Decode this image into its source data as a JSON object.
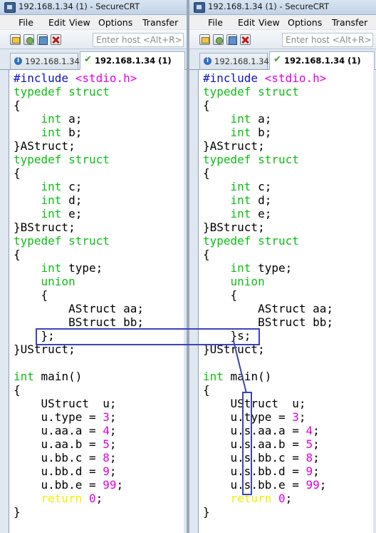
{
  "windows": [
    {
      "title": "192.168.1.34 (1) - SecureCRT",
      "menu": [
        "File",
        "Edit",
        "View",
        "Options",
        "Transfer"
      ],
      "host_placeholder": "Enter host <Alt+R>",
      "tabs": [
        {
          "label": "192.168.1.34",
          "icon": "info-icon",
          "active": false
        },
        {
          "label": "192.168.1.34 (1)",
          "icon": "check-icon",
          "active": true
        }
      ],
      "code": [
        [
          [
            "#include ",
            "pre"
          ],
          [
            "<stdio.h>",
            "inc"
          ]
        ],
        [
          [
            "typedef struct",
            "type"
          ]
        ],
        [
          [
            "{",
            ""
          ]
        ],
        [
          [
            "    ",
            ""
          ],
          [
            "int",
            "type"
          ],
          [
            " a;",
            ""
          ]
        ],
        [
          [
            "    ",
            ""
          ],
          [
            "int",
            "type"
          ],
          [
            " b;",
            ""
          ]
        ],
        [
          [
            "}AStruct;",
            ""
          ]
        ],
        [
          [
            "typedef struct",
            "type"
          ]
        ],
        [
          [
            "{",
            ""
          ]
        ],
        [
          [
            "    ",
            ""
          ],
          [
            "int",
            "type"
          ],
          [
            " c;",
            ""
          ]
        ],
        [
          [
            "    ",
            ""
          ],
          [
            "int",
            "type"
          ],
          [
            " d;",
            ""
          ]
        ],
        [
          [
            "    ",
            ""
          ],
          [
            "int",
            "type"
          ],
          [
            " e;",
            ""
          ]
        ],
        [
          [
            "}BStruct;",
            ""
          ]
        ],
        [
          [
            "typedef struct",
            "type"
          ]
        ],
        [
          [
            "{",
            ""
          ]
        ],
        [
          [
            "    ",
            ""
          ],
          [
            "int",
            "type"
          ],
          [
            " type;",
            ""
          ]
        ],
        [
          [
            "    ",
            ""
          ],
          [
            "union",
            "type"
          ]
        ],
        [
          [
            "    {",
            ""
          ]
        ],
        [
          [
            "        AStruct aa;",
            ""
          ]
        ],
        [
          [
            "        BStruct bb;",
            ""
          ]
        ],
        [
          [
            "    };",
            ""
          ]
        ],
        [
          [
            "}UStruct;",
            ""
          ]
        ],
        [
          [
            "",
            ""
          ]
        ],
        [
          [
            "int",
            "type"
          ],
          [
            " main()",
            ""
          ]
        ],
        [
          [
            "{",
            ""
          ]
        ],
        [
          [
            "    UStruct  u;",
            ""
          ]
        ],
        [
          [
            "    u.type = ",
            ""
          ],
          [
            "3",
            "num"
          ],
          [
            ";",
            ""
          ]
        ],
        [
          [
            "    u.aa.a = ",
            ""
          ],
          [
            "4",
            "num"
          ],
          [
            ";",
            ""
          ]
        ],
        [
          [
            "    u.aa.b = ",
            ""
          ],
          [
            "5",
            "num"
          ],
          [
            ";",
            ""
          ]
        ],
        [
          [
            "    u.bb.c = ",
            ""
          ],
          [
            "8",
            "num"
          ],
          [
            ";",
            ""
          ]
        ],
        [
          [
            "    u.bb.d = ",
            ""
          ],
          [
            "9",
            "num"
          ],
          [
            ";",
            ""
          ]
        ],
        [
          [
            "    u.bb.e = ",
            ""
          ],
          [
            "99",
            "num"
          ],
          [
            ";",
            ""
          ]
        ],
        [
          [
            "    ",
            ""
          ],
          [
            "return",
            "ret"
          ],
          [
            " ",
            ""
          ],
          [
            "0",
            "num"
          ],
          [
            ";",
            ""
          ]
        ],
        [
          [
            "}",
            ""
          ]
        ]
      ]
    },
    {
      "title": "192.168.1.34 (1) - SecureCRT",
      "menu": [
        "File",
        "Edit",
        "View",
        "Options",
        "Transfer"
      ],
      "host_placeholder": "Enter host <Alt+R>",
      "tabs": [
        {
          "label": "192.168.1.34",
          "icon": "info-icon",
          "active": false
        },
        {
          "label": "192.168.1.34 (1)",
          "icon": "check-icon",
          "active": true
        }
      ],
      "code": [
        [
          [
            "#include ",
            "pre"
          ],
          [
            "<stdio.h>",
            "inc"
          ]
        ],
        [
          [
            "typedef struct",
            "type"
          ]
        ],
        [
          [
            "{",
            ""
          ]
        ],
        [
          [
            "    ",
            ""
          ],
          [
            "int",
            "type"
          ],
          [
            " a;",
            ""
          ]
        ],
        [
          [
            "    ",
            ""
          ],
          [
            "int",
            "type"
          ],
          [
            " b;",
            ""
          ]
        ],
        [
          [
            "}AStruct;",
            ""
          ]
        ],
        [
          [
            "typedef struct",
            "type"
          ]
        ],
        [
          [
            "{",
            ""
          ]
        ],
        [
          [
            "    ",
            ""
          ],
          [
            "int",
            "type"
          ],
          [
            " c;",
            ""
          ]
        ],
        [
          [
            "    ",
            ""
          ],
          [
            "int",
            "type"
          ],
          [
            " d;",
            ""
          ]
        ],
        [
          [
            "    ",
            ""
          ],
          [
            "int",
            "type"
          ],
          [
            " e;",
            ""
          ]
        ],
        [
          [
            "}BStruct;",
            ""
          ]
        ],
        [
          [
            "typedef struct",
            "type"
          ]
        ],
        [
          [
            "{",
            ""
          ]
        ],
        [
          [
            "    ",
            ""
          ],
          [
            "int",
            "type"
          ],
          [
            " type;",
            ""
          ]
        ],
        [
          [
            "    ",
            ""
          ],
          [
            "union",
            "type"
          ]
        ],
        [
          [
            "    {",
            ""
          ]
        ],
        [
          [
            "        AStruct aa;",
            ""
          ]
        ],
        [
          [
            "        BStruct bb;",
            ""
          ]
        ],
        [
          [
            "    }s;",
            ""
          ]
        ],
        [
          [
            "}UStruct;",
            ""
          ]
        ],
        [
          [
            "",
            ""
          ]
        ],
        [
          [
            "int",
            "type"
          ],
          [
            " main()",
            ""
          ]
        ],
        [
          [
            "{",
            ""
          ]
        ],
        [
          [
            "    UStruct  u;",
            ""
          ]
        ],
        [
          [
            "    u.type = ",
            ""
          ],
          [
            "3",
            "num"
          ],
          [
            ";",
            ""
          ]
        ],
        [
          [
            "    u.s.aa.a = ",
            ""
          ],
          [
            "4",
            "num"
          ],
          [
            ";",
            ""
          ]
        ],
        [
          [
            "    u.s.aa.b = ",
            ""
          ],
          [
            "5",
            "num"
          ],
          [
            ";",
            ""
          ]
        ],
        [
          [
            "    u.s.bb.c = ",
            ""
          ],
          [
            "8",
            "num"
          ],
          [
            ";",
            ""
          ]
        ],
        [
          [
            "    u.s.bb.d = ",
            ""
          ],
          [
            "9",
            "num"
          ],
          [
            ";",
            ""
          ]
        ],
        [
          [
            "    u.s.bb.e = ",
            ""
          ],
          [
            "99",
            "num"
          ],
          [
            ";",
            ""
          ]
        ],
        [
          [
            "    ",
            ""
          ],
          [
            "return",
            "ret"
          ],
          [
            " ",
            ""
          ],
          [
            "0",
            "num"
          ],
          [
            ";",
            ""
          ]
        ],
        [
          [
            "}",
            ""
          ]
        ]
      ]
    }
  ],
  "colors": {
    "preprocessor": "#1010c8",
    "include": "#e000e0",
    "type_keyword": "#0bbf12",
    "number": "#e000e0",
    "return_keyword": "#f0f000",
    "annotation": "#3b44b8"
  }
}
